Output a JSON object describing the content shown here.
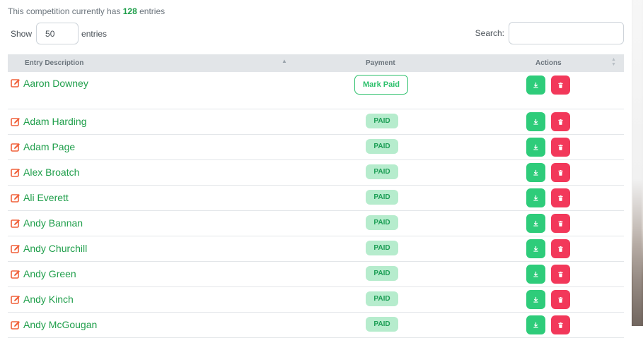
{
  "summary": {
    "prefix": "This competition currently has",
    "count": "128",
    "suffix": "entries"
  },
  "length_control": {
    "show_label": "Show",
    "value": "50",
    "entries_label": "entries"
  },
  "search": {
    "label": "Search:",
    "value": ""
  },
  "table": {
    "headers": {
      "description": "Entry Description",
      "payment": "Payment",
      "actions": "Actions"
    },
    "mark_paid_label": "Mark Paid",
    "paid_label": "PAID",
    "rows": [
      {
        "name": "Aaron Downey",
        "payment": "Mark Paid"
      },
      {
        "name": "Adam Harding",
        "payment": "PAID"
      },
      {
        "name": "Adam Page",
        "payment": "PAID"
      },
      {
        "name": "Alex Broatch",
        "payment": "PAID"
      },
      {
        "name": "Ali Everett",
        "payment": "PAID"
      },
      {
        "name": "Andy Bannan",
        "payment": "PAID"
      },
      {
        "name": "Andy Churchill",
        "payment": "PAID"
      },
      {
        "name": "Andy Green",
        "payment": "PAID"
      },
      {
        "name": "Andy Kinch",
        "payment": "PAID"
      },
      {
        "name": "Andy McGougan",
        "payment": "PAID"
      }
    ]
  },
  "icons": {
    "edit": "edit-icon",
    "download": "download-icon",
    "delete": "trash-icon",
    "sort_asc": "sort-asc-icon",
    "sort_both": "sort-icon"
  },
  "colors": {
    "name_green": "#1e9e4a",
    "edit_orange": "#f0603a",
    "paid_badge_bg": "#b6eccd",
    "download_green": "#2ecc7a",
    "delete_red": "#f2385a",
    "header_bg": "#e2e5e8"
  }
}
